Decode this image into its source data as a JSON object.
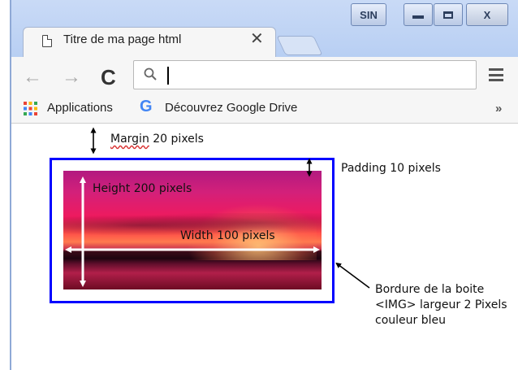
{
  "window": {
    "tab_title": "Titre de ma page html",
    "tab_close": "✕",
    "sin_label": "SIN",
    "close_label": "X"
  },
  "toolbar": {
    "back": "←",
    "forward": "→",
    "reload": "C",
    "address_value": ""
  },
  "bookmarks": {
    "apps_label": "Applications",
    "drive_g": "G",
    "drive_label": "Découvrez Google Drive",
    "more": "»"
  },
  "annotations": {
    "margin_word": "Margin",
    "margin_rest": " 20 pixels",
    "padding": "Padding 10 pixels",
    "height": "Height 200 pixels",
    "width": "Width 100 pixels",
    "border_line1": "Bordure de la boite",
    "border_line2": "<IMG> largeur 2 Pixels",
    "border_line3": "couleur bleu"
  },
  "colors": {
    "box_border": "#0000ff",
    "arrow_white": "#ffffff",
    "arrow_black": "#000000"
  }
}
